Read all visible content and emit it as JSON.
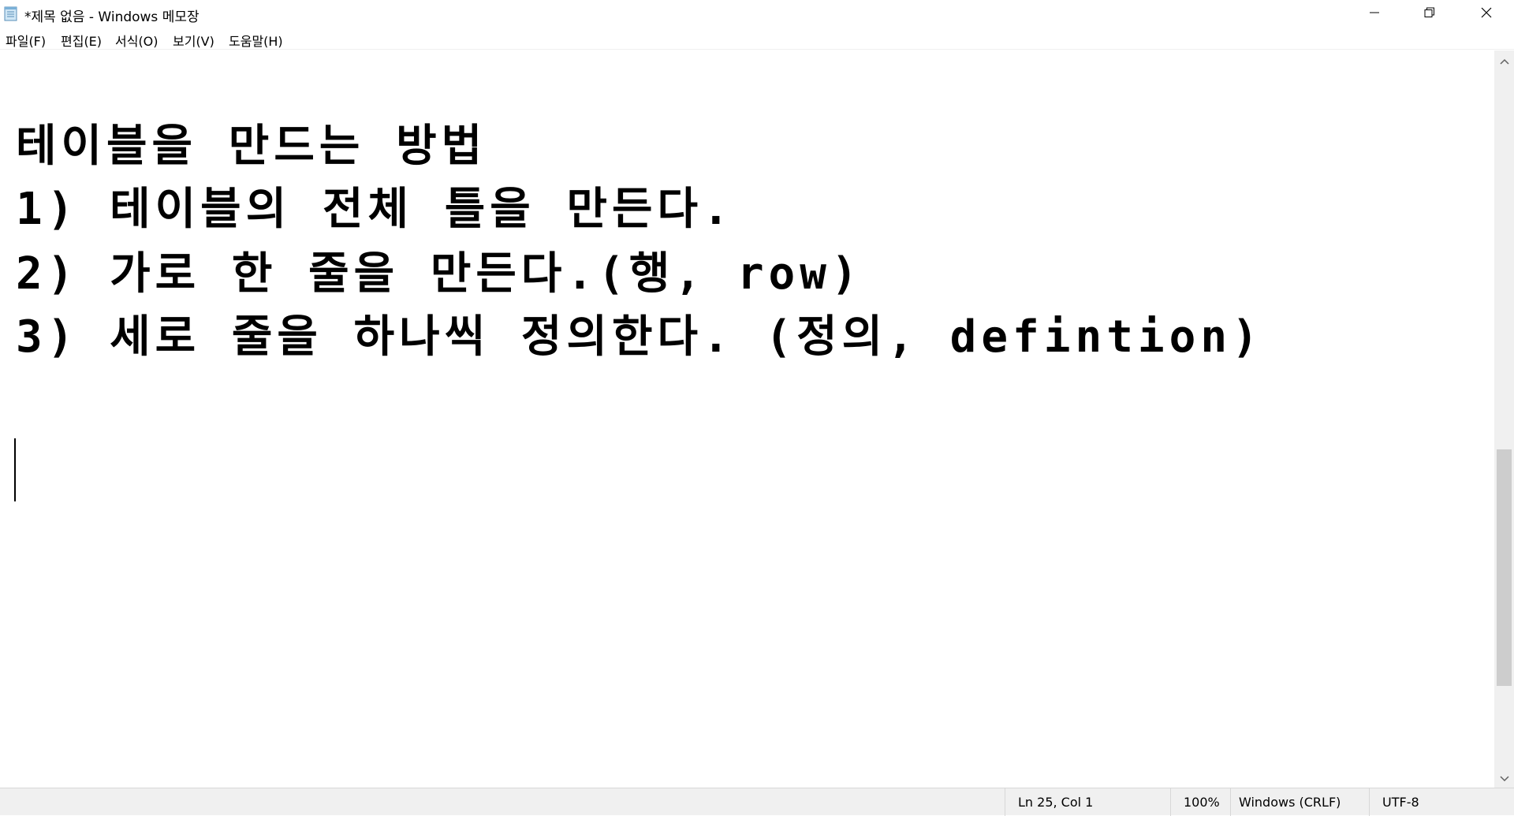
{
  "titlebar": {
    "title": "*제목 없음 - Windows 메모장",
    "icon": "notepad-icon",
    "minimize_icon": "minimize-icon",
    "maximize_icon": "restore-icon",
    "close_icon": "close-icon"
  },
  "menu": {
    "items": [
      {
        "label": "파일(F)"
      },
      {
        "label": "편집(E)"
      },
      {
        "label": "서식(O)"
      },
      {
        "label": "보기(V)"
      },
      {
        "label": "도움말(H)"
      }
    ]
  },
  "editor": {
    "lines": [
      "테이블을 만드는 방법",
      "1) 테이블의 전체 틀을 만든다.",
      "2) 가로 한 줄을 만든다.(행, row)",
      "3) 세로 줄을 하나씩 정의한다. (정의, defintion)"
    ]
  },
  "statusbar": {
    "position": "Ln 25, Col 1",
    "zoom": "100%",
    "line_ending": "Windows (CRLF)",
    "encoding": "UTF-8"
  },
  "colors": {
    "background": "#ffffff",
    "text": "#000000",
    "statusbar_bg": "#f0f0f0",
    "scrollbar_thumb": "#cdcdcd"
  }
}
